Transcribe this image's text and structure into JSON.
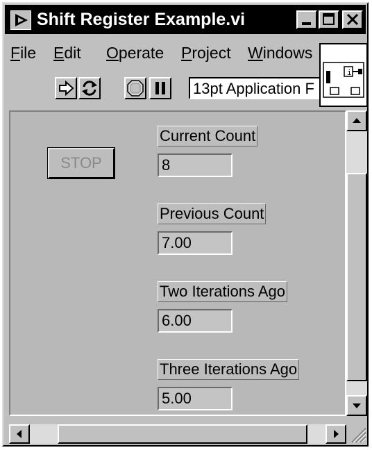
{
  "window": {
    "title": "Shift Register Example.vi",
    "icon": "labview-vi-icon",
    "controls": [
      "minimize-icon",
      "maximize-icon",
      "close-icon"
    ]
  },
  "menu": {
    "items": [
      {
        "label": "File",
        "mnemonic": "F",
        "rest": "ile"
      },
      {
        "label": "Edit",
        "mnemonic": "E",
        "rest": "dit"
      },
      {
        "label": "Operate",
        "mnemonic": "O",
        "rest": "perate"
      },
      {
        "label": "Project",
        "mnemonic": "P",
        "rest": "roject"
      },
      {
        "label": "Windows",
        "mnemonic": "W",
        "rest": "indows"
      }
    ]
  },
  "toolbar": {
    "tools": [
      "run-arrow-icon",
      "run-continuously-icon",
      "abort-execution-icon",
      "pause-icon"
    ],
    "font_ring": "13pt Application F"
  },
  "panel": {
    "stop_button": "STOP",
    "indicators": [
      {
        "label": "Current Count",
        "value": "8"
      },
      {
        "label": "Previous Count",
        "value": "7.00"
      },
      {
        "label": "Two Iterations Ago",
        "value": "6.00"
      },
      {
        "label": "Three Iterations Ago",
        "value": "5.00"
      }
    ]
  },
  "colors": {
    "title_bar": "#000000",
    "window_face": "#c0c0c0",
    "panel_bg": "#b8b8b8"
  }
}
